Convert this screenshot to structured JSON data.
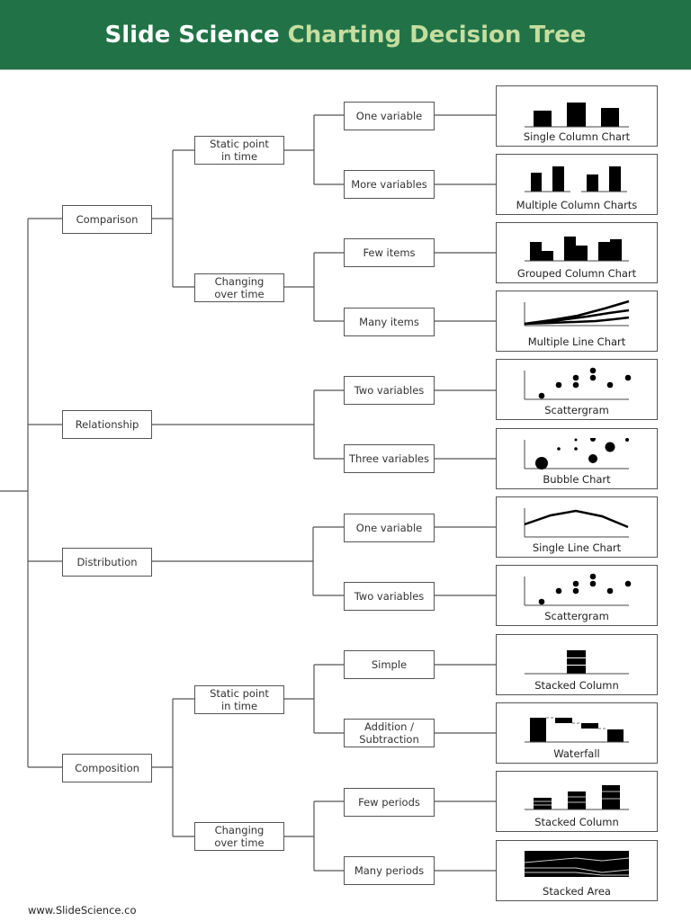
{
  "header": {
    "title_part1": "Slide Science",
    "title_part2": "Charting Decision Tree",
    "background_color": "#217347",
    "accent_text_color": "#c5dd9f"
  },
  "tree": {
    "categories": [
      {
        "label": "Comparison",
        "branches": [
          {
            "label": "Static point\nin time",
            "options": [
              {
                "label": "One variable",
                "chart": "Single Column Chart"
              },
              {
                "label": "More variables",
                "chart": "Multiple Column Charts"
              }
            ]
          },
          {
            "label": "Changing\nover time",
            "options": [
              {
                "label": "Few items",
                "chart": "Grouped Column Chart"
              },
              {
                "label": "Many items",
                "chart": "Multiple Line Chart"
              }
            ]
          }
        ]
      },
      {
        "label": "Relationship",
        "options": [
          {
            "label": "Two variables",
            "chart": "Scattergram"
          },
          {
            "label": "Three variables",
            "chart": "Bubble Chart"
          }
        ]
      },
      {
        "label": "Distribution",
        "options": [
          {
            "label": "One variable",
            "chart": "Single Line Chart"
          },
          {
            "label": "Two variables",
            "chart": "Scattergram"
          }
        ]
      },
      {
        "label": "Composition",
        "branches": [
          {
            "label": "Static point\nin time",
            "options": [
              {
                "label": "Simple",
                "chart": "Stacked Column"
              },
              {
                "label": "Addition /\nSubtraction",
                "chart": "Waterfall"
              }
            ]
          },
          {
            "label": "Changing\nover time",
            "options": [
              {
                "label": "Few periods",
                "chart": "Stacked Column"
              },
              {
                "label": "Many periods",
                "chart": "Stacked Area"
              }
            ]
          }
        ]
      }
    ]
  },
  "footer": {
    "url": "www.SlideScience.co"
  }
}
